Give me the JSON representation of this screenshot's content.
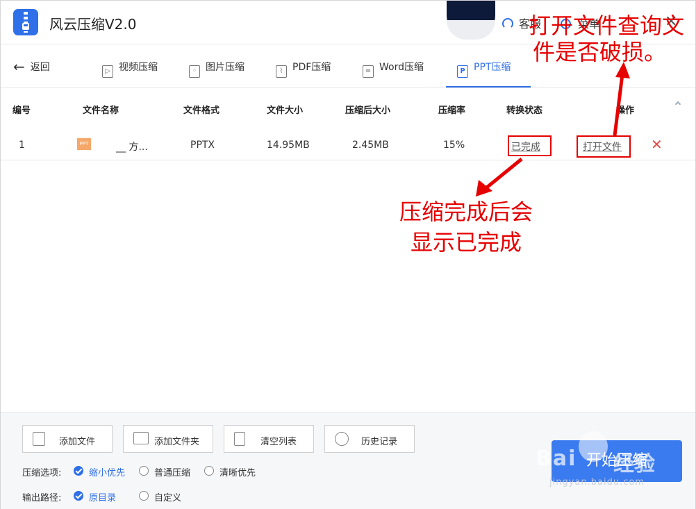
{
  "app": {
    "title": "风云压缩V2.0",
    "support_label": "客服",
    "menu_label": "菜单",
    "close_glyph": "✕"
  },
  "nav": {
    "back_label": "返回",
    "tabs": [
      {
        "label": "视频压缩",
        "icon": "video-file-icon"
      },
      {
        "label": "图片压缩",
        "icon": "image-file-icon"
      },
      {
        "label": "PDF压缩",
        "icon": "pdf-file-icon"
      },
      {
        "label": "Word压缩",
        "icon": "word-file-icon"
      },
      {
        "label": "PPT压缩",
        "icon": "ppt-file-icon",
        "active": true
      }
    ]
  },
  "table": {
    "headers": [
      "编号",
      "文件名称",
      "文件格式",
      "文件大小",
      "压缩后大小",
      "压缩率",
      "转换状态",
      "操作"
    ],
    "rows": [
      {
        "index": "1",
        "icon_text": "PPT",
        "name": "__ 方...",
        "format": "PPTX",
        "size": "14.95MB",
        "compressed_size": "2.45MB",
        "ratio": "15%",
        "status": "已完成",
        "action": "打开文件",
        "delete": "✕"
      }
    ]
  },
  "annotations": {
    "top_right": [
      "打开文件查询文",
      "件是否破损。"
    ],
    "middle": [
      "压缩完成后会",
      "显示已完成"
    ],
    "color": "#e60000"
  },
  "bottom": {
    "buttons": [
      "添加文件",
      "添加文件夹",
      "清空列表",
      "历史记录"
    ],
    "compress_option_label": "压缩选项:",
    "compress_options": [
      {
        "label": "缩小优先",
        "selected": true
      },
      {
        "label": "普通压缩",
        "selected": false
      },
      {
        "label": "清晰优先",
        "selected": false
      }
    ],
    "output_path_label": "输出路径:",
    "output_options": [
      {
        "label": "原目录",
        "selected": true
      },
      {
        "label": "自定义",
        "selected": false
      }
    ],
    "start_button": "开始压缩"
  },
  "watermark": {
    "brand_left": "Bai",
    "brand_right": "经验",
    "url": "jingyan.baidu.com"
  },
  "colors": {
    "accent": "#2f6fe8",
    "start_button": "#3b7bf0",
    "delete": "#e84a4a"
  }
}
